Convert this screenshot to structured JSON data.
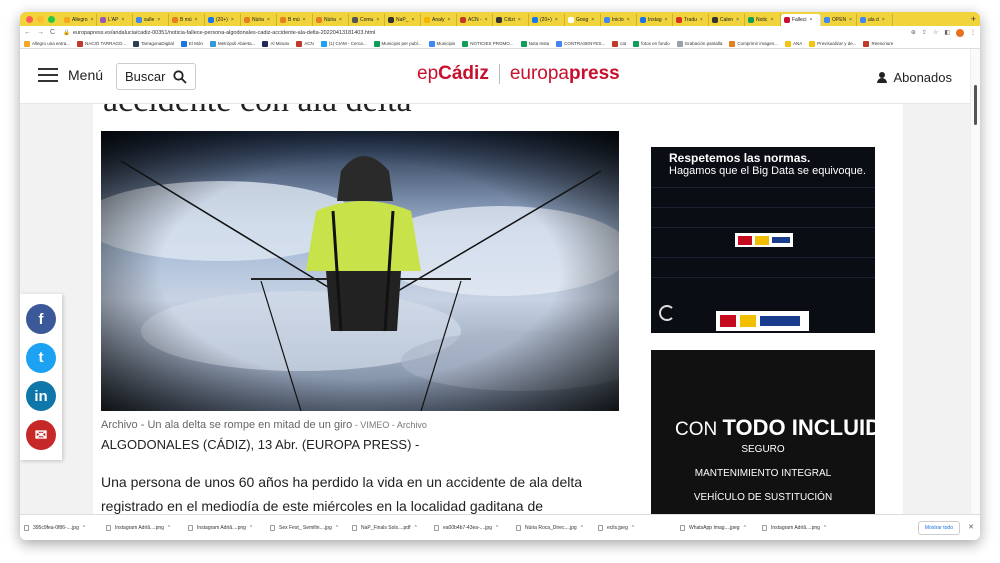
{
  "browser": {
    "tabs": [
      {
        "label": "Allegro",
        "color": "#f5a623"
      },
      {
        "label": "L'AP",
        "color": "#9b59b6"
      },
      {
        "label": "sulle",
        "color": "#4285f4"
      },
      {
        "label": "B mú",
        "color": "#e67e22"
      },
      {
        "label": "(20+)",
        "color": "#1877f2"
      },
      {
        "label": "Núria",
        "color": "#e67e22"
      },
      {
        "label": "B mú",
        "color": "#e67e22"
      },
      {
        "label": "Núria",
        "color": "#e67e22"
      },
      {
        "label": "Comu",
        "color": "#555555"
      },
      {
        "label": "NaP_",
        "color": "#333333"
      },
      {
        "label": "Analy",
        "color": "#f4b400"
      },
      {
        "label": "ACN -",
        "color": "#c0392b"
      },
      {
        "label": "Citizi",
        "color": "#333333"
      },
      {
        "label": "(20+)",
        "color": "#1877f2"
      },
      {
        "label": "Goog",
        "color": "#ffffff"
      },
      {
        "label": "Inicio",
        "color": "#4285f4"
      },
      {
        "label": "Instag",
        "color": "#1a73e8"
      },
      {
        "label": "Tradu",
        "color": "#d93025"
      },
      {
        "label": "Calen",
        "color": "#333333"
      },
      {
        "label": "Notic",
        "color": "#0f9d58"
      },
      {
        "label": "Falleci",
        "color": "#c8102e",
        "active": true
      },
      {
        "label": "OPEN",
        "color": "#4285f4"
      },
      {
        "label": "ala d",
        "color": "#4285f4"
      }
    ],
    "url": "europapress.es/andalucia/cadiz-00351/noticia-fallece-persona-algodonales-cadiz-accidente-ala-delta-20220413181403.html",
    "bookmarks": [
      {
        "label": "Allegro una entra...",
        "color": "#f5a623"
      },
      {
        "label": "NACIÓ TARRAGO...",
        "color": "#c0392b"
      },
      {
        "label": "TarragonaDigital",
        "color": "#2c3e50"
      },
      {
        "label": "El Món",
        "color": "#1a73e8"
      },
      {
        "label": "Metròpoli Abierta...",
        "color": "#3498db"
      },
      {
        "label": "Al Minuto",
        "color": "#1f2a5a"
      },
      {
        "label": "ACN",
        "color": "#c0392b"
      },
      {
        "label": "(1) CIAM - Cerca...",
        "color": "#1da1f2"
      },
      {
        "label": "Municipis per publ...",
        "color": "#0f9d58"
      },
      {
        "label": "Municipis",
        "color": "#4285f4"
      },
      {
        "label": "NOTICIES PROMO...",
        "color": "#0f9d58"
      },
      {
        "label": "Nota Insta",
        "color": "#0f9d58"
      },
      {
        "label": "CONTRASENYES...",
        "color": "#4285f4"
      },
      {
        "label": "cat",
        "color": "#c0392b"
      },
      {
        "label": "fotos en fondo",
        "color": "#0f9d58"
      },
      {
        "label": "Grabación pantalla",
        "color": "#9aa0a6"
      },
      {
        "label": "Comprimir imagen...",
        "color": "#e67e22"
      },
      {
        "label": "ANA",
        "color": "#f1c40f"
      },
      {
        "label": "Previsualizar y de...",
        "color": "#f1c40f"
      },
      {
        "label": "Reescriure",
        "color": "#c0392b"
      }
    ]
  },
  "header": {
    "menu_label": "Menú",
    "search_label": "Buscar",
    "logo_ep": "ep",
    "logo_city": "Cádiz",
    "logo_europa": "europa",
    "logo_press": "press",
    "abonados_label": "Abonados"
  },
  "article": {
    "headline": "accidente con ala delta",
    "caption": "Archivo - Un ala delta se rompe en mitad de un giro",
    "caption_source": " - VIMEO - Archivo",
    "dateline": "ALGODONALES (CÁDIZ), 13 Abr. (EUROPA PRESS) -",
    "body": "Una persona de unos 60 años ha perdido la vida en un accidente de ala delta registrado en el mediodía de este miércoles en la localidad gaditana de Algodonales,"
  },
  "ads": {
    "ad1_line1": "Respetemos las normas.",
    "ad1_line2": "Hagamos que el Big Data se equivoque.",
    "ad2_prefix": "CON ",
    "ad2_bold": "TODO INCLUIDO:",
    "ad2_items": [
      "SEGURO",
      "MANTENIMIENTO INTEGRAL",
      "VEHÍCULO DE SUSTITUCIÓN"
    ]
  },
  "share": [
    {
      "name": "facebook",
      "glyph": "f",
      "color": "#3b5998"
    },
    {
      "name": "twitter",
      "glyph": "t",
      "color": "#1da1f2"
    },
    {
      "name": "linkedin",
      "glyph": "in",
      "color": "#0e76a8"
    },
    {
      "name": "email",
      "glyph": "✉",
      "color": "#c62828"
    }
  ],
  "downloads": {
    "items": [
      "395c9fea-0f86-....jpg",
      "Instagram Adriã....png",
      "Instagram Adriã....png",
      "Sex Fest_ Semifin....jpg",
      "NaP_Finals Sols....pdf",
      "ea00b4b7-43ea-....jpg",
      "Núria Roca_Direc....jpg",
      "ecils.jpeg",
      "WhatsApp Imag....jpeg",
      "Instagram Adriã....png"
    ],
    "show_all": "Mostrar todo",
    "close": "✕"
  }
}
